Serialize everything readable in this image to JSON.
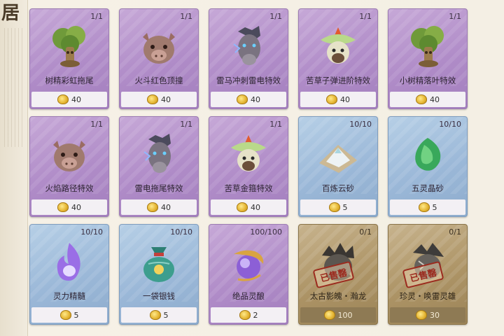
{
  "side_glyph": "居",
  "items": [
    {
      "name": "树精彩虹拖尾",
      "count": "1/1",
      "price": "40",
      "rarity": "purple",
      "icon": "tree-spirit-icon",
      "sold": false
    },
    {
      "name": "火斗红色顶撞",
      "count": "1/1",
      "price": "40",
      "rarity": "purple",
      "icon": "boar-pet-icon",
      "sold": false
    },
    {
      "name": "雷马冲刺雷电特效",
      "count": "1/1",
      "price": "40",
      "rarity": "purple",
      "icon": "thunder-horse-icon",
      "sold": false
    },
    {
      "name": "苦草子弹进阶特效",
      "count": "1/1",
      "price": "40",
      "rarity": "purple",
      "icon": "grass-sprite-icon",
      "sold": false
    },
    {
      "name": "小树精落叶特效",
      "count": "1/1",
      "price": "40",
      "rarity": "purple",
      "icon": "tree-spirit-icon",
      "sold": false
    },
    {
      "name": "火焰路径特效",
      "count": "1/1",
      "price": "40",
      "rarity": "purple",
      "icon": "boar-pet-icon",
      "sold": false
    },
    {
      "name": "雷电拖尾特效",
      "count": "1/1",
      "price": "40",
      "rarity": "purple",
      "icon": "thunder-horse-icon",
      "sold": false
    },
    {
      "name": "苦草金箍特效",
      "count": "1/1",
      "price": "40",
      "rarity": "purple",
      "icon": "grass-sprite-icon",
      "sold": false
    },
    {
      "name": "百炼云砂",
      "count": "10/10",
      "price": "5",
      "rarity": "blue",
      "icon": "cloud-sand-icon",
      "sold": false
    },
    {
      "name": "五灵晶砂",
      "count": "10/10",
      "price": "5",
      "rarity": "blue",
      "icon": "green-crystal-icon",
      "sold": false
    },
    {
      "name": "灵力精髓",
      "count": "10/10",
      "price": "5",
      "rarity": "blue",
      "icon": "spirit-flame-icon",
      "sold": false
    },
    {
      "name": "一袋银钱",
      "count": "10/10",
      "price": "5",
      "rarity": "blue",
      "icon": "money-bag-icon",
      "sold": false
    },
    {
      "name": "绝品灵酿",
      "count": "100/100",
      "price": "2",
      "rarity": "purple",
      "icon": "spirit-orb-icon",
      "sold": false
    },
    {
      "name": "太古影魄・瀚龙",
      "count": "0/1",
      "price": "100",
      "rarity": "gold",
      "icon": "shadow-dragon-icon",
      "sold": true,
      "sold_label": "已售罄"
    },
    {
      "name": "珍灵・唤雷灵雄",
      "count": "0/1",
      "price": "30",
      "rarity": "gold",
      "icon": "thunder-beast-icon",
      "sold": true,
      "sold_label": "已售罄"
    }
  ],
  "colors": {
    "purple_card": "#b08cc8",
    "blue_card": "#9bb8d8",
    "gold_card": "#ad9466",
    "sold_stamp": "#9b2a1e"
  }
}
